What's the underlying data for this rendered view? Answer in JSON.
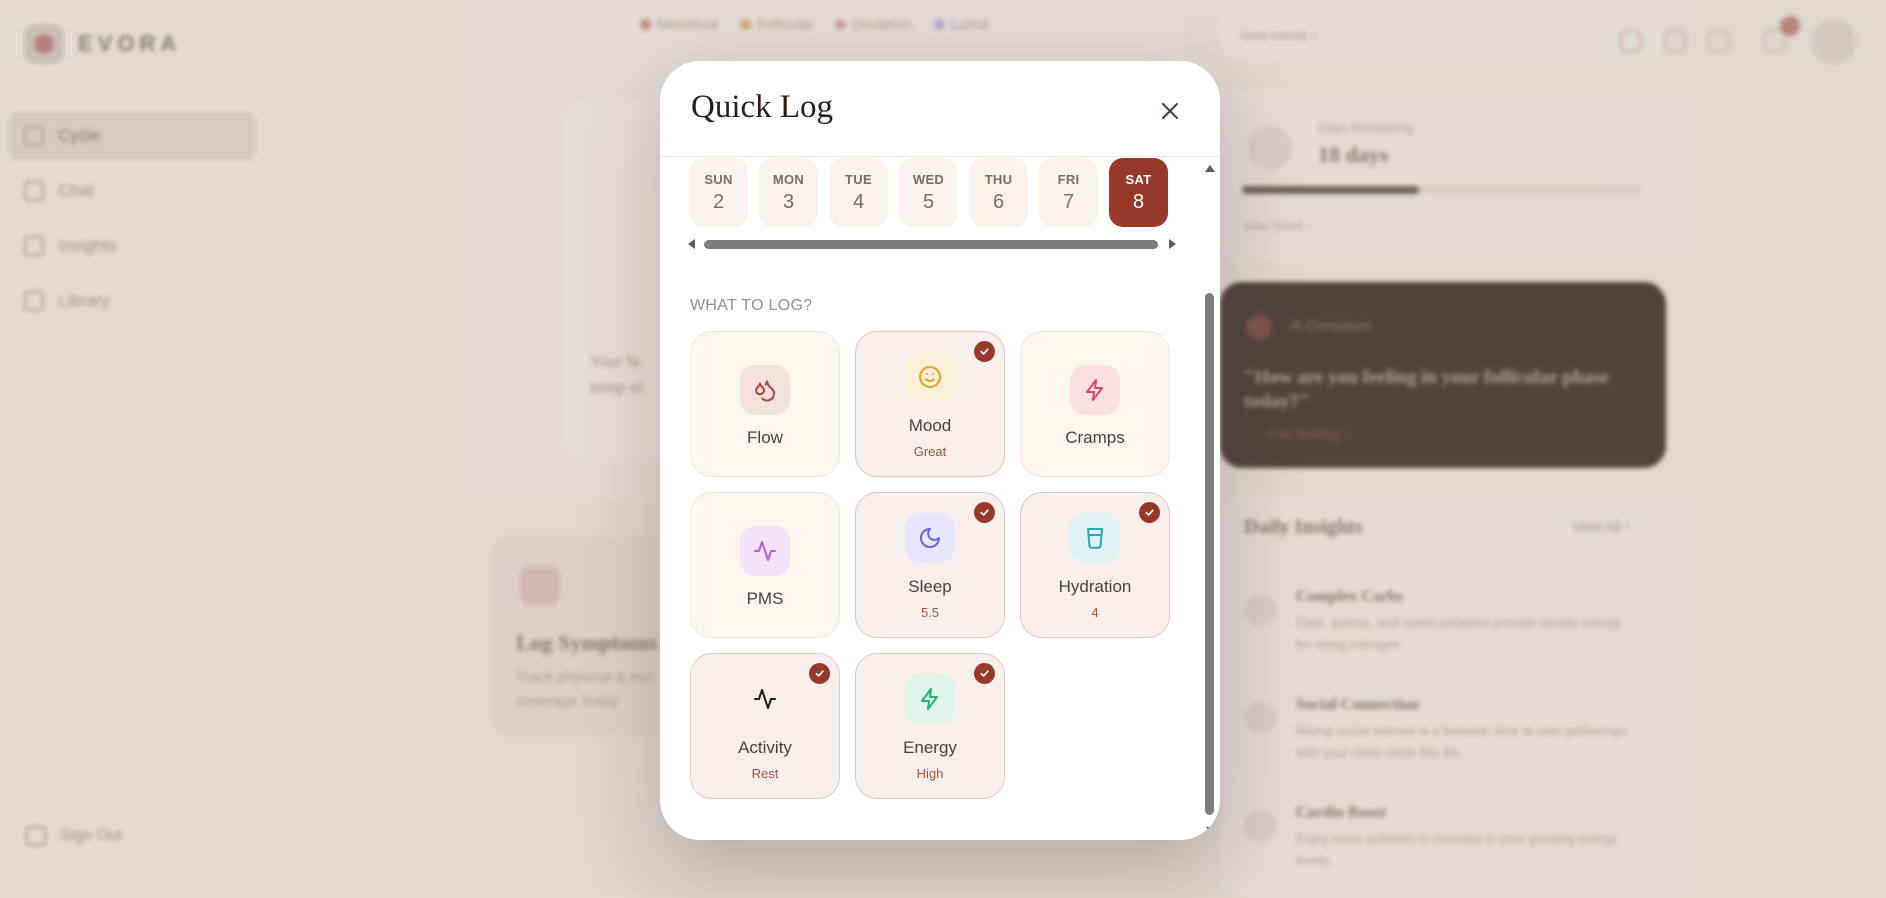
{
  "background": {
    "app_name": "EVORA",
    "nav": [
      {
        "label": "Cycle",
        "icon": "calendar-icon",
        "active": true
      },
      {
        "label": "Chat",
        "icon": "chat-icon",
        "active": false
      },
      {
        "label": "Insights",
        "icon": "chart-icon",
        "active": false
      },
      {
        "label": "Library",
        "icon": "book-icon",
        "active": false
      }
    ],
    "sign_out": "Sign Out",
    "legend": [
      "Menstrual",
      "Follicular",
      "Ovulation",
      "Luteal"
    ],
    "legend_colors": [
      "#c9908a",
      "#d7b97a",
      "#d9a6ad",
      "#b9b4d6"
    ],
    "center_text_1": "Your fe",
    "center_text_2": "temp el",
    "log_title": "Log Symptoms",
    "log_sub_1": "Track physical & mo",
    "log_sub_2": "coverage today",
    "top_link": "View trends ›",
    "days_label": "Days Remaining",
    "days_value": "18 days",
    "days_progress": 0.44,
    "days_link": "View more ›",
    "ai_label": "AI Companion",
    "ai_question": "\"How are you feeling in your follicular phase today?\"",
    "ai_cta": "Add feeling ›",
    "insights_title": "Daily Insights",
    "insights_view": "View All ›",
    "insights": [
      {
        "name": "Complex Carbs",
        "desc": "Oats, quinoa, and sweet potatoes provide steady energy for rising estrogen."
      },
      {
        "name": "Social Connection",
        "desc": "Rising social interest is a fantastic time to plan gatherings with your close circle this life."
      },
      {
        "name": "Cardio Boost",
        "desc": "Enjoy more activities to increase in your growing energy levels."
      }
    ]
  },
  "modal": {
    "title": "Quick Log",
    "close_icon": "close-icon",
    "section_label": "WHAT TO LOG?",
    "days": [
      {
        "name": "SUN",
        "num": "2",
        "selected": false
      },
      {
        "name": "MON",
        "num": "3",
        "selected": false
      },
      {
        "name": "TUE",
        "num": "4",
        "selected": false
      },
      {
        "name": "WED",
        "num": "5",
        "selected": false
      },
      {
        "name": "THU",
        "num": "6",
        "selected": false
      },
      {
        "name": "FRI",
        "num": "7",
        "selected": false
      },
      {
        "name": "SAT",
        "num": "8",
        "selected": true
      }
    ],
    "tiles": [
      {
        "key": "flow",
        "label": "Flow",
        "value": "",
        "checked": false,
        "icon": "droplets-icon",
        "icon_bg": "#f3e1dd",
        "icon_color": "#a9473a"
      },
      {
        "key": "mood",
        "label": "Mood",
        "value": "Great",
        "checked": true,
        "icon": "smile-icon",
        "icon_bg": "#fcefd9",
        "icon_color": "#e6a21f"
      },
      {
        "key": "cramps",
        "label": "Cramps",
        "value": "",
        "checked": false,
        "icon": "zap-icon",
        "icon_bg": "#fde0e4",
        "icon_color": "#e0445f"
      },
      {
        "key": "pms",
        "label": "PMS",
        "value": "",
        "checked": false,
        "icon": "activity-icon",
        "icon_bg": "#f3e3f8",
        "icon_color": "#b45ee0"
      },
      {
        "key": "sleep",
        "label": "Sleep",
        "value": "5.5",
        "checked": true,
        "icon": "moon-icon",
        "icon_bg": "#e8e6fa",
        "icon_color": "#6c63d8"
      },
      {
        "key": "hydration",
        "label": "Hydration",
        "value": "4",
        "checked": true,
        "icon": "cup-icon",
        "icon_bg": "#dff3f5",
        "icon_color": "#2aa6b8"
      },
      {
        "key": "activity",
        "label": "Activity",
        "value": "Rest",
        "checked": true,
        "icon": "activity-icon",
        "icon_bg": "transparent",
        "icon_color": "#1e1e1e"
      },
      {
        "key": "energy",
        "label": "Energy",
        "value": "High",
        "checked": true,
        "icon": "zap-icon",
        "icon_bg": "#dff4ea",
        "icon_color": "#22b06a"
      }
    ],
    "accent_color": "#96392b"
  }
}
